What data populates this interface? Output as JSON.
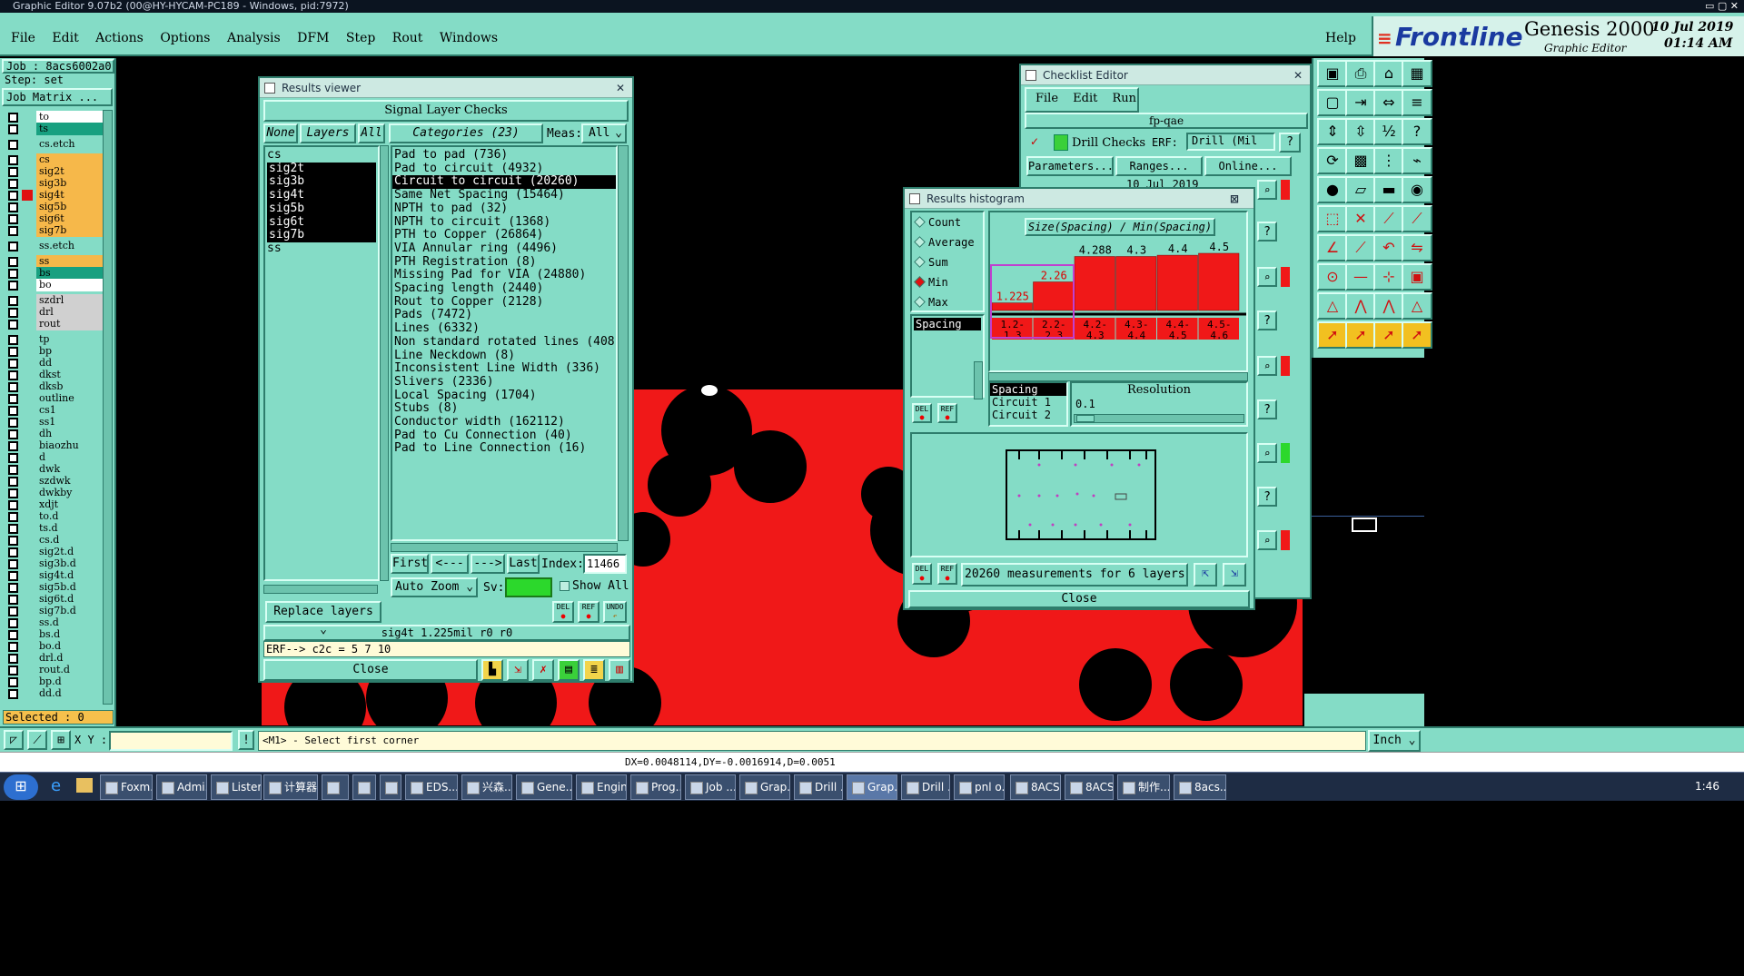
{
  "titlebar": {
    "text": "Graphic Editor 9.07b2 (00@HY-HYCAM-PC189 - Windows, pid:7972)"
  },
  "menubar": {
    "items": [
      "File",
      "Edit",
      "Actions",
      "Options",
      "Analysis",
      "DFM",
      "Step",
      "Rout",
      "Windows"
    ],
    "help": "Help",
    "brand": "Frontline",
    "product": "Genesis 2000",
    "subtitle": "Graphic Editor",
    "date": "10 Jul 2019",
    "time": "01:14 AM"
  },
  "left_panel": {
    "job": "Job : 8acs6002a0",
    "step": "Step: set",
    "job_matrix": "Job Matrix ...",
    "layers": [
      {
        "name": "to",
        "color": "white"
      },
      {
        "name": "ts",
        "color": "green"
      },
      {
        "name": "cs.etch",
        "color": "teal"
      },
      {
        "name": "cs",
        "color": "orange"
      },
      {
        "name": "sig2t",
        "color": "orange"
      },
      {
        "name": "sig3b",
        "color": "orange"
      },
      {
        "name": "sig4t",
        "color": "orange"
      },
      {
        "name": "sig5b",
        "color": "orange"
      },
      {
        "name": "sig6t",
        "color": "orange"
      },
      {
        "name": "sig7b",
        "color": "orange"
      },
      {
        "name": "ss.etch",
        "color": "teal"
      },
      {
        "name": "ss",
        "color": "orange"
      },
      {
        "name": "bs",
        "color": "green"
      },
      {
        "name": "bo",
        "color": "white"
      },
      {
        "name": "szdrl",
        "color": "grey"
      },
      {
        "name": "drl",
        "color": "grey"
      },
      {
        "name": "rout",
        "color": "grey"
      },
      {
        "name": "tp",
        "color": "teal"
      },
      {
        "name": "bp",
        "color": "teal"
      },
      {
        "name": "dd",
        "color": "teal"
      },
      {
        "name": "dkst",
        "color": "teal"
      },
      {
        "name": "dksb",
        "color": "teal"
      },
      {
        "name": "outline",
        "color": "teal"
      },
      {
        "name": "cs1",
        "color": "teal"
      },
      {
        "name": "ss1",
        "color": "teal"
      },
      {
        "name": "dh",
        "color": "teal"
      },
      {
        "name": "biaozhu",
        "color": "teal"
      },
      {
        "name": "d",
        "color": "teal"
      },
      {
        "name": "dwk",
        "color": "teal"
      },
      {
        "name": "szdwk",
        "color": "teal"
      },
      {
        "name": "dwkby",
        "color": "teal"
      },
      {
        "name": "xdjt",
        "color": "teal"
      },
      {
        "name": "to.d",
        "color": "teal"
      },
      {
        "name": "ts.d",
        "color": "teal"
      },
      {
        "name": "cs.d",
        "color": "teal"
      },
      {
        "name": "sig2t.d",
        "color": "teal"
      },
      {
        "name": "sig3b.d",
        "color": "teal"
      },
      {
        "name": "sig4t.d",
        "color": "teal"
      },
      {
        "name": "sig5b.d",
        "color": "teal"
      },
      {
        "name": "sig6t.d",
        "color": "teal"
      },
      {
        "name": "sig7b.d",
        "color": "teal"
      },
      {
        "name": "ss.d",
        "color": "teal"
      },
      {
        "name": "bs.d",
        "color": "teal"
      },
      {
        "name": "bo.d",
        "color": "teal"
      },
      {
        "name": "drl.d",
        "color": "teal"
      },
      {
        "name": "rout.d",
        "color": "teal"
      },
      {
        "name": "bp.d",
        "color": "teal"
      },
      {
        "name": "dd.d",
        "color": "teal"
      }
    ],
    "selected": "Selected : 0"
  },
  "results_viewer": {
    "title": "Results viewer",
    "header": "Signal Layer Checks",
    "none": "None",
    "layers_btn": "Layers",
    "all_btn": "All",
    "categories": "Categories (23)",
    "meas_label": "Meas:",
    "meas_value": "All",
    "layer_list": [
      "cs",
      "sig2t",
      "sig3b",
      "sig4t",
      "sig5b",
      "sig6t",
      "sig7b",
      "ss"
    ],
    "category_list": [
      "Pad to pad (736)",
      "Pad to circuit (4932)",
      "Circuit to circuit (20260)",
      "Same Net Spacing (15464)",
      "NPTH to pad (32)",
      "NPTH to circuit (1368)",
      "PTH to Copper (26864)",
      "VIA Annular ring (4496)",
      "PTH Registration (8)",
      "Missing Pad for VIA (24880)",
      "Spacing length (2440)",
      "Rout to Copper (2128)",
      "Pads (7472)",
      "Lines (6332)",
      "Non standard rotated lines (408)",
      "Line Neckdown (8)",
      "Inconsistent Line Width (336)",
      "Slivers (2336)",
      "Local Spacing (1704)",
      "Stubs (8)",
      "Conductor width (162112)",
      "Pad to Cu Connection (40)",
      "Pad to Line Connection (16)"
    ],
    "first": "First",
    "prev": "<---",
    "next": "--->",
    "last": "Last",
    "index_label": "Index:",
    "index_value": "11466",
    "auto_zoom": "Auto Zoom",
    "sv_label": "Sv:",
    "show_all": "Show All",
    "replace_layers": "Replace layers",
    "status": "sig4t 1.225mil  r0  r0",
    "erf": "ERF--> c2c = 5 7 10",
    "close": "Close",
    "del": "DEL",
    "ref": "REF",
    "undo": "UNDO"
  },
  "checklist_editor": {
    "title": "Checklist Editor",
    "menu": [
      "File",
      "Edit",
      "Run"
    ],
    "name": "fp-qae",
    "check": "Drill Checks",
    "erf_label": "ERF:",
    "erf_value": "Drill (Mil",
    "parameters": "Parameters...",
    "ranges": "Ranges...",
    "online": "Online...",
    "date": "10 Jul 2019"
  },
  "histogram": {
    "title": "Results histogram",
    "radio": [
      "Count",
      "Average",
      "Sum",
      "Min",
      "Max"
    ],
    "selected_radio": "Min",
    "header": "Size(Spacing) / Min(Spacing)",
    "list": [
      "Spacing"
    ],
    "bars": [
      {
        "value": "1.225",
        "range": "1.2-1.3",
        "level": 0.12
      },
      {
        "value": "2.26",
        "range": "2.2-2.3",
        "level": 0.45
      },
      {
        "value": "4.288",
        "range": "4.2-4.3",
        "level": 0.85
      },
      {
        "value": "4.3",
        "range": "4.3-4.4",
        "level": 0.85
      },
      {
        "value": "4.4",
        "range": "4.4-4.5",
        "level": 0.87
      },
      {
        "value": "4.5",
        "range": "4.5-4.6",
        "level": 0.9
      }
    ],
    "legend": [
      "Spacing",
      "Circuit 1",
      "Circuit 2"
    ],
    "resolution_label": "Resolution",
    "resolution_value": "0.1",
    "measurements": "20260 measurements for 6 layers",
    "close": "Close",
    "del": "DEL",
    "ref": "REF"
  },
  "statusbar": {
    "xy_label": "X Y :",
    "prompt": "<M1> - Select first corner",
    "units": "Inch",
    "coords": "DX=0.0048114,DY=-0.0016914,D=0.0051"
  },
  "taskbar": {
    "items": [
      "Foxm...",
      "Admi...",
      "Lister...",
      "计算器",
      "",
      "",
      "",
      "EDS...",
      "兴森...",
      "Gene...",
      "Engin...",
      "Prog...",
      "Job ...",
      "Grap...",
      "Drill ...",
      "Grap...",
      "Drill ...",
      "pnl o...",
      "8ACS...",
      "8ACS...",
      "制作...",
      "8acs..."
    ],
    "time": "1:46"
  },
  "colors": {
    "teal": "#84dcc6",
    "red": "#f01818",
    "black": "#000000",
    "title_bg": "#000000"
  }
}
